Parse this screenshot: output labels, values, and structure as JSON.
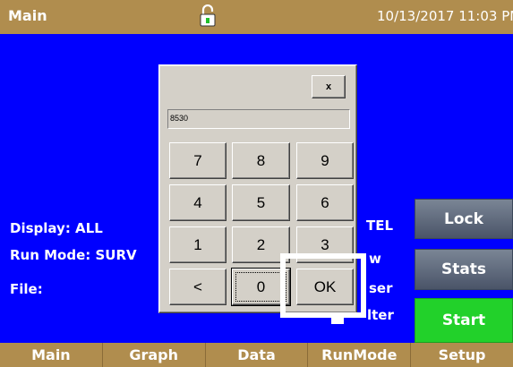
{
  "titlebar": {
    "title": "Main",
    "datetime": "10/13/2017 11:03 PM",
    "lock_icon": "unlocked-padlock-icon"
  },
  "status": {
    "display": "Display: ALL",
    "run_mode": "Run Mode: SURV",
    "file": "File:"
  },
  "behind_labels": {
    "tel": "TEL",
    "w": "w",
    "ser": "ser",
    "lter": "lter"
  },
  "side_buttons": {
    "lock": "Lock",
    "stats": "Stats",
    "start": "Start"
  },
  "keypad": {
    "close": "x",
    "value": "8530",
    "keys": [
      "7",
      "8",
      "9",
      "4",
      "5",
      "6",
      "1",
      "2",
      "3",
      "<",
      "0",
      "OK"
    ]
  },
  "nav": {
    "tabs": [
      "Main",
      "Graph",
      "Data",
      "RunMode",
      "Setup"
    ]
  },
  "colors": {
    "background": "#0000ff",
    "bar": "#b08d4e",
    "start": "#22d12a",
    "side_gray": "#5a6478"
  }
}
